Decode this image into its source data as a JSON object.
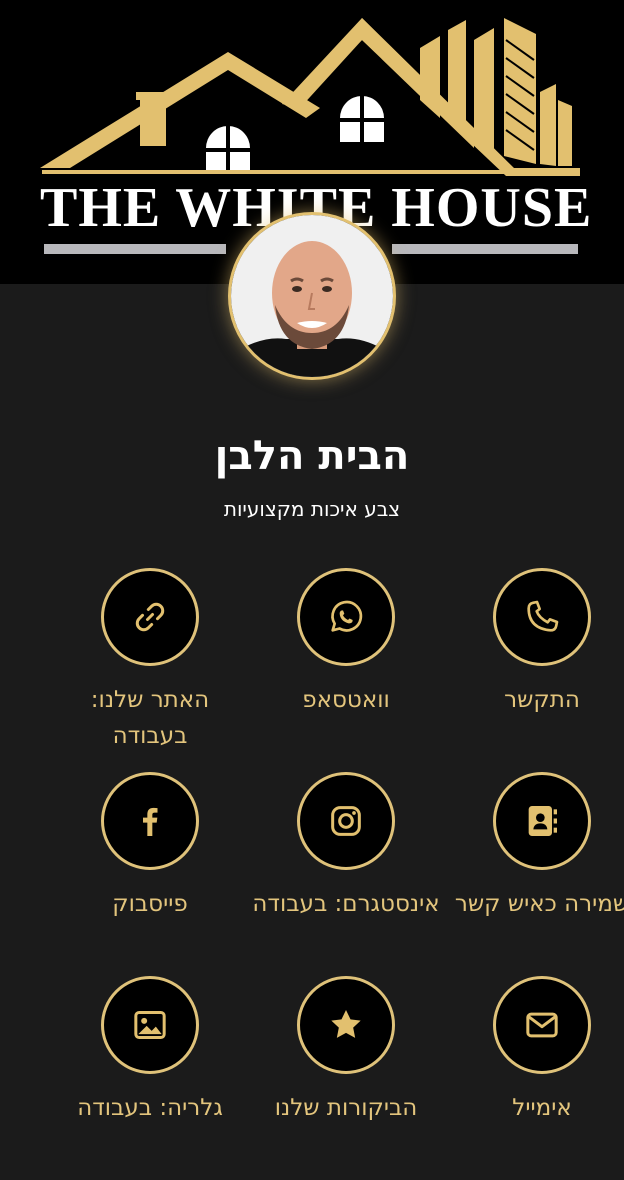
{
  "header": {
    "logo_text": "THE WHITE HOUSE"
  },
  "profile": {
    "name": "הבית הלבן",
    "tagline": "צבע איכות מקצועיות"
  },
  "actions": [
    {
      "label": "התקשר",
      "icon": "phone-icon"
    },
    {
      "label": "וואטסאפ",
      "icon": "whatsapp-icon"
    },
    {
      "label": "האתר שלנו: בעבודה",
      "icon": "link-icon"
    },
    {
      "label": "שמירה כאיש קשר",
      "icon": "contact-book-icon"
    },
    {
      "label": "אינסטגרם: בעבודה",
      "icon": "instagram-icon"
    },
    {
      "label": "פייסבוק",
      "icon": "facebook-icon"
    },
    {
      "label": "אימייל",
      "icon": "mail-icon"
    },
    {
      "label": "הביקורות שלנו",
      "icon": "star-icon"
    },
    {
      "label": "גלריה: בעבודה",
      "icon": "gallery-icon"
    }
  ],
  "colors": {
    "gold": "#e2c06f",
    "background": "#1b1b1b",
    "header": "#000000"
  }
}
